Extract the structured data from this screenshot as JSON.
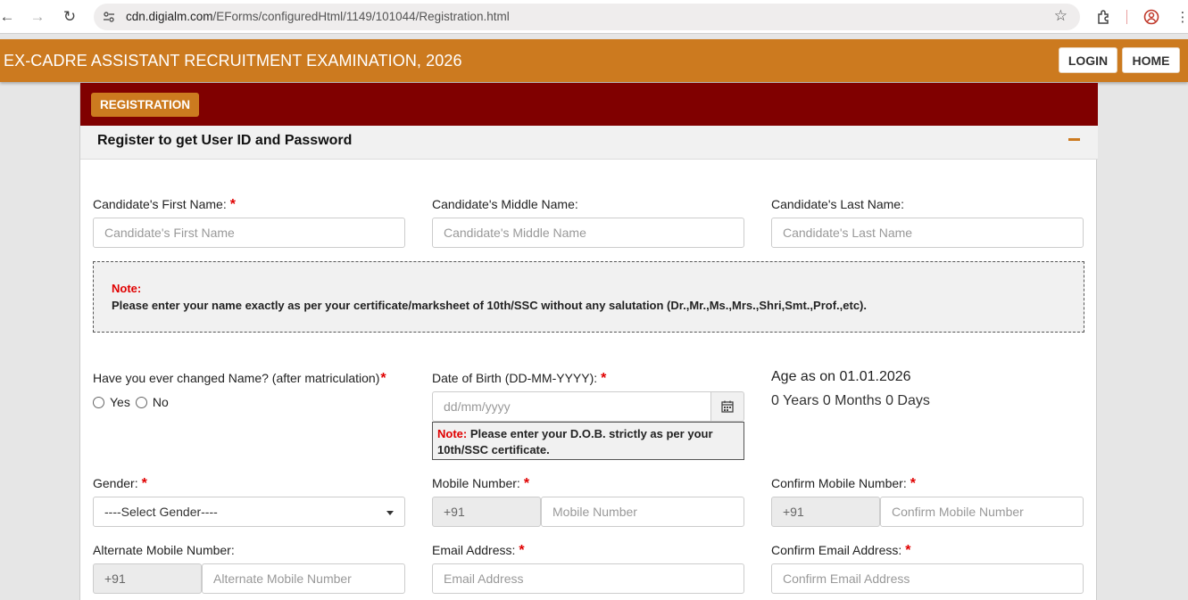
{
  "browser": {
    "url_host": "cdn.digialm.com",
    "url_path": "/EForms/configuredHtml/1149/101044/Registration.html"
  },
  "header": {
    "title": "EX-CADRE ASSISTANT RECRUITMENT EXAMINATION, 2026",
    "login_label": "LOGIN",
    "home_label": "HOME"
  },
  "registration": {
    "tab_label": "REGISTRATION",
    "panel_title": "Register to get User ID and Password"
  },
  "form": {
    "first_name": {
      "label": "Candidate's First Name:",
      "placeholder": "Candidate's First Name"
    },
    "middle_name": {
      "label": "Candidate's Middle Name:",
      "placeholder": "Candidate's Middle Name"
    },
    "last_name": {
      "label": "Candidate's Last Name:",
      "placeholder": "Candidate's Last Name"
    },
    "name_note": {
      "title": "Note:",
      "text": "Please enter your name exactly as per your certificate/marksheet of 10th/SSC without any salutation (Dr.,Mr.,Ms.,Mrs.,Shri,Smt.,Prof.,etc)."
    },
    "name_changed": {
      "label": "Have you ever changed Name? (after matriculation)",
      "yes": "Yes",
      "no": "No"
    },
    "dob": {
      "label": "Date of Birth (DD-MM-YYYY):",
      "placeholder": "dd/mm/yyyy",
      "note_prefix": "Note:",
      "note_text": "Please enter your D.O.B. strictly as per your 10th/SSC certificate."
    },
    "age": {
      "label": "Age as on 01.01.2026",
      "value": "0 Years 0 Months 0 Days"
    },
    "gender": {
      "label": "Gender:",
      "selected": "----Select Gender----"
    },
    "mobile": {
      "label": "Mobile Number:",
      "prefix": "+91",
      "placeholder": "Mobile Number"
    },
    "confirm_mobile": {
      "label": "Confirm Mobile Number:",
      "prefix": "+91",
      "placeholder": "Confirm Mobile Number"
    },
    "alt_mobile": {
      "label": "Alternate Mobile Number:",
      "prefix": "+91",
      "placeholder": "Alternate Mobile Number"
    },
    "email": {
      "label": "Email Address:",
      "placeholder": "Email Address"
    },
    "confirm_email": {
      "label": "Confirm Email Address:",
      "placeholder": "Confirm Email Address"
    },
    "required_mark": "*"
  },
  "colors": {
    "header_orange": "#cc7a1f",
    "registration_bar": "#800000",
    "required_red": "#e00000"
  }
}
